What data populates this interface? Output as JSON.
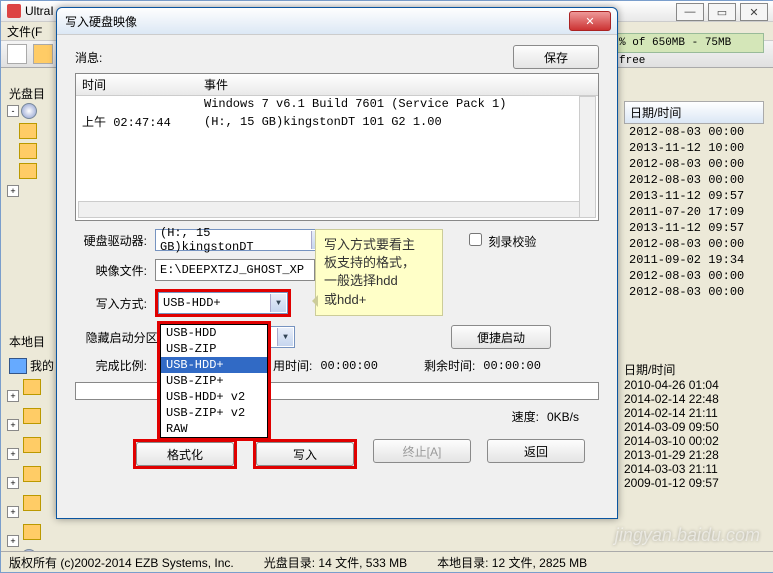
{
  "app": {
    "title": "UltraI",
    "menu_file": "文件(F"
  },
  "wincontrols": {
    "min": "—",
    "max": "▭",
    "close": "✕"
  },
  "tree_lbl": "光盘目",
  "topbar": "% of 650MB - 75MB free",
  "local_lbl": "本地目",
  "mycomp": "我的",
  "rpanel": {
    "hdr": "日期/时间",
    "rows": [
      "2012-08-03 00:00",
      "2013-11-12 10:00",
      "2012-08-03 00:00",
      "2012-08-03 00:00",
      "2013-11-12 09:57",
      "2011-07-20 17:09",
      "2013-11-12 09:57",
      "2012-08-03 00:00",
      "2011-09-02 19:34",
      "2012-08-03 00:00",
      "2012-08-03 00:00"
    ]
  },
  "rpanel2": {
    "hdr": "日期/时间",
    "rows": [
      "2010-04-26 01:04",
      "2014-02-14 22:48",
      "2014-02-14 21:11",
      "2014-03-09 09:50",
      "2014-03-10 00:02",
      "2013-01-29 21:28",
      "2014-03-03 21:11",
      "2009-01-12 09:57"
    ]
  },
  "dlg": {
    "title": "写入硬盘映像",
    "close": "✕",
    "msg_lbl": "消息:",
    "save_btn": "保存",
    "log": {
      "h_time": "时间",
      "h_event": "事件",
      "r1_time": "",
      "r1_event": "Windows 7 v6.1 Build 7601  (Service Pack 1)",
      "r2_time": "上午 02:47:44",
      "r2_event": "(H:, 15 GB)kingstonDT 101 G2       1.00"
    },
    "drive_lbl": "硬盘驱动器:",
    "drive_val": "(H:, 15 GB)kingstonDT",
    "drive_chk": "刻录校验",
    "image_lbl": "映像文件:",
    "image_val": "E:\\DEEPXTZJ_GHOST_XP",
    "write_lbl": "写入方式:",
    "write_val": "USB-HDD+",
    "hide_lbl": "隐藏启动分区:",
    "boot_btn": "便捷启动",
    "ratio_lbl": "完成比例:",
    "elapsed_lbl": "用时间:",
    "elapsed_val": "00:00:00",
    "remain_lbl": "剩余时间:",
    "remain_val": "00:00:00",
    "speed_lbl": "速度:",
    "speed_val": "0KB/s",
    "btn_format": "格式化",
    "btn_write": "写入",
    "btn_abort": "终止[A]",
    "btn_return": "返回",
    "opts": [
      "USB-HDD",
      "USB-ZIP",
      "USB-HDD+",
      "USB-ZIP+",
      "USB-HDD+ v2",
      "USB-ZIP+ v2",
      "RAW"
    ]
  },
  "annot": {
    "l1": "写入方式要看主",
    "l2": "板支持的格式，",
    "l3": "一般选择hdd",
    "l4": "或hdd+"
  },
  "status": {
    "copyright": "版权所有 (c)2002-2014 EZB Systems, Inc.",
    "info": "光盘目录: 14 文件, 533 MB",
    "local": "本地目录: 12 文件, 2825 MB"
  },
  "watermark": "jingyan.baidu.com"
}
